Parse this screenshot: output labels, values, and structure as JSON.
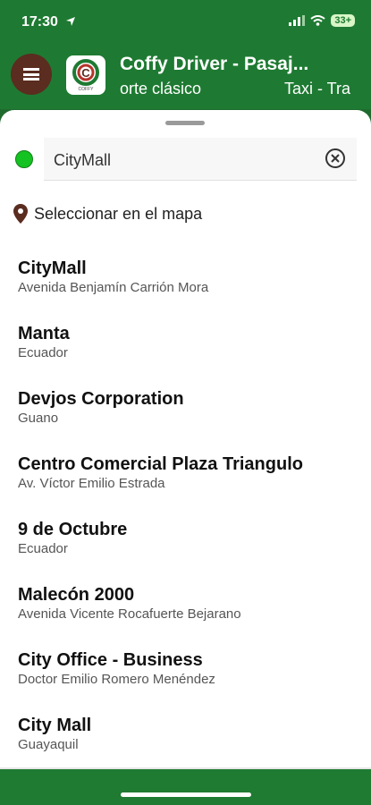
{
  "status_bar": {
    "time": "17:30",
    "battery": "33+",
    "icons": [
      "location-arrow-icon",
      "signal-icon",
      "wifi-icon",
      "battery-icon"
    ]
  },
  "header": {
    "title": "Coffy Driver - Pasaj...",
    "subtitle_left": "orte clásico",
    "subtitle_right": "Taxi - Tra",
    "logo_letter": "C",
    "logo_caption": "COFFY"
  },
  "search": {
    "value": "CityMall",
    "placeholder": ""
  },
  "map_select": {
    "label": "Seleccionar en el mapa"
  },
  "results": [
    {
      "title": "CityMall",
      "subtitle": "Avenida Benjamín Carrión Mora"
    },
    {
      "title": "Manta",
      "subtitle": "Ecuador"
    },
    {
      "title": "Devjos Corporation",
      "subtitle": "Guano"
    },
    {
      "title": "Centro Comercial Plaza Triangulo",
      "subtitle": "Av. Víctor Emilio Estrada"
    },
    {
      "title": "9 de Octubre",
      "subtitle": "Ecuador"
    },
    {
      "title": "Malecón 2000",
      "subtitle": "Avenida Vicente Rocafuerte Bejarano"
    },
    {
      "title": "City Office - Business",
      "subtitle": "Doctor Emilio Romero Menéndez"
    },
    {
      "title": "City Mall",
      "subtitle": "Guayaquil"
    }
  ],
  "colors": {
    "brand_green": "#1e7a32",
    "menu_brown": "#5b2c20",
    "origin_dot": "#14c221"
  }
}
